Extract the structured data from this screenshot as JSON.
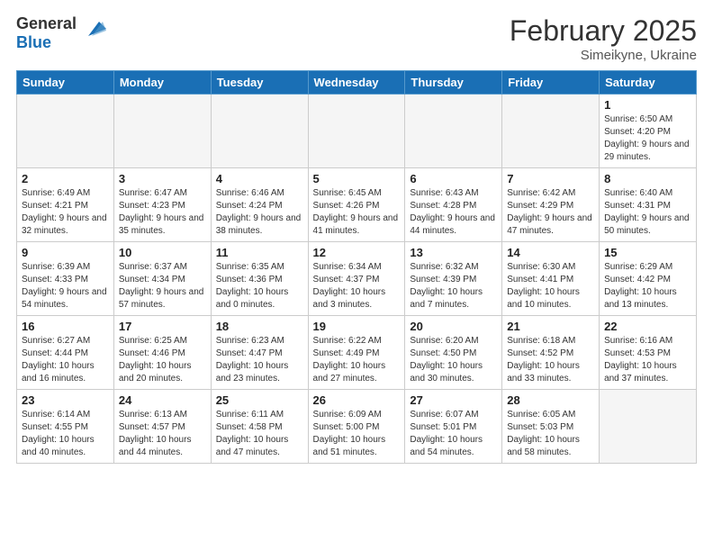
{
  "header": {
    "logo_general": "General",
    "logo_blue": "Blue",
    "month_title": "February 2025",
    "subtitle": "Simeikyne, Ukraine"
  },
  "weekdays": [
    "Sunday",
    "Monday",
    "Tuesday",
    "Wednesday",
    "Thursday",
    "Friday",
    "Saturday"
  ],
  "weeks": [
    [
      {
        "day": "",
        "info": ""
      },
      {
        "day": "",
        "info": ""
      },
      {
        "day": "",
        "info": ""
      },
      {
        "day": "",
        "info": ""
      },
      {
        "day": "",
        "info": ""
      },
      {
        "day": "",
        "info": ""
      },
      {
        "day": "1",
        "info": "Sunrise: 6:50 AM\nSunset: 4:20 PM\nDaylight: 9 hours and 29 minutes."
      }
    ],
    [
      {
        "day": "2",
        "info": "Sunrise: 6:49 AM\nSunset: 4:21 PM\nDaylight: 9 hours and 32 minutes."
      },
      {
        "day": "3",
        "info": "Sunrise: 6:47 AM\nSunset: 4:23 PM\nDaylight: 9 hours and 35 minutes."
      },
      {
        "day": "4",
        "info": "Sunrise: 6:46 AM\nSunset: 4:24 PM\nDaylight: 9 hours and 38 minutes."
      },
      {
        "day": "5",
        "info": "Sunrise: 6:45 AM\nSunset: 4:26 PM\nDaylight: 9 hours and 41 minutes."
      },
      {
        "day": "6",
        "info": "Sunrise: 6:43 AM\nSunset: 4:28 PM\nDaylight: 9 hours and 44 minutes."
      },
      {
        "day": "7",
        "info": "Sunrise: 6:42 AM\nSunset: 4:29 PM\nDaylight: 9 hours and 47 minutes."
      },
      {
        "day": "8",
        "info": "Sunrise: 6:40 AM\nSunset: 4:31 PM\nDaylight: 9 hours and 50 minutes."
      }
    ],
    [
      {
        "day": "9",
        "info": "Sunrise: 6:39 AM\nSunset: 4:33 PM\nDaylight: 9 hours and 54 minutes."
      },
      {
        "day": "10",
        "info": "Sunrise: 6:37 AM\nSunset: 4:34 PM\nDaylight: 9 hours and 57 minutes."
      },
      {
        "day": "11",
        "info": "Sunrise: 6:35 AM\nSunset: 4:36 PM\nDaylight: 10 hours and 0 minutes."
      },
      {
        "day": "12",
        "info": "Sunrise: 6:34 AM\nSunset: 4:37 PM\nDaylight: 10 hours and 3 minutes."
      },
      {
        "day": "13",
        "info": "Sunrise: 6:32 AM\nSunset: 4:39 PM\nDaylight: 10 hours and 7 minutes."
      },
      {
        "day": "14",
        "info": "Sunrise: 6:30 AM\nSunset: 4:41 PM\nDaylight: 10 hours and 10 minutes."
      },
      {
        "day": "15",
        "info": "Sunrise: 6:29 AM\nSunset: 4:42 PM\nDaylight: 10 hours and 13 minutes."
      }
    ],
    [
      {
        "day": "16",
        "info": "Sunrise: 6:27 AM\nSunset: 4:44 PM\nDaylight: 10 hours and 16 minutes."
      },
      {
        "day": "17",
        "info": "Sunrise: 6:25 AM\nSunset: 4:46 PM\nDaylight: 10 hours and 20 minutes."
      },
      {
        "day": "18",
        "info": "Sunrise: 6:23 AM\nSunset: 4:47 PM\nDaylight: 10 hours and 23 minutes."
      },
      {
        "day": "19",
        "info": "Sunrise: 6:22 AM\nSunset: 4:49 PM\nDaylight: 10 hours and 27 minutes."
      },
      {
        "day": "20",
        "info": "Sunrise: 6:20 AM\nSunset: 4:50 PM\nDaylight: 10 hours and 30 minutes."
      },
      {
        "day": "21",
        "info": "Sunrise: 6:18 AM\nSunset: 4:52 PM\nDaylight: 10 hours and 33 minutes."
      },
      {
        "day": "22",
        "info": "Sunrise: 6:16 AM\nSunset: 4:53 PM\nDaylight: 10 hours and 37 minutes."
      }
    ],
    [
      {
        "day": "23",
        "info": "Sunrise: 6:14 AM\nSunset: 4:55 PM\nDaylight: 10 hours and 40 minutes."
      },
      {
        "day": "24",
        "info": "Sunrise: 6:13 AM\nSunset: 4:57 PM\nDaylight: 10 hours and 44 minutes."
      },
      {
        "day": "25",
        "info": "Sunrise: 6:11 AM\nSunset: 4:58 PM\nDaylight: 10 hours and 47 minutes."
      },
      {
        "day": "26",
        "info": "Sunrise: 6:09 AM\nSunset: 5:00 PM\nDaylight: 10 hours and 51 minutes."
      },
      {
        "day": "27",
        "info": "Sunrise: 6:07 AM\nSunset: 5:01 PM\nDaylight: 10 hours and 54 minutes."
      },
      {
        "day": "28",
        "info": "Sunrise: 6:05 AM\nSunset: 5:03 PM\nDaylight: 10 hours and 58 minutes."
      },
      {
        "day": "",
        "info": ""
      }
    ]
  ]
}
